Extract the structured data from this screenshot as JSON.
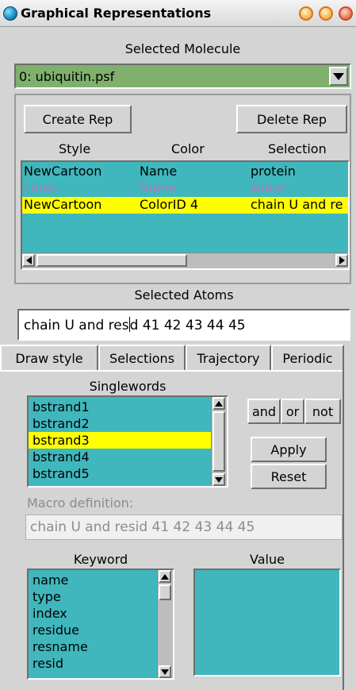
{
  "window": {
    "title": "Graphical Representations"
  },
  "molecule": {
    "label": "Selected Molecule",
    "value": "0: ubiquitin.psf"
  },
  "reps": {
    "create_label": "Create Rep",
    "delete_label": "Delete Rep",
    "columns": [
      "Style",
      "Color",
      "Selection"
    ],
    "rows": [
      {
        "style": "NewCartoon",
        "color": "Name",
        "selection": "protein"
      },
      {
        "style": "Lines",
        "color": "Name",
        "selection": "water"
      },
      {
        "style": "NewCartoon",
        "color": "ColorID 4",
        "selection": "chain U and re"
      }
    ]
  },
  "atoms": {
    "label": "Selected Atoms",
    "before_cursor": "chain U and res",
    "after_cursor": "d 41 42 43 44 45"
  },
  "tabs": [
    "Draw style",
    "Selections",
    "Trajectory",
    "Periodic"
  ],
  "singlewords": {
    "label": "Singlewords",
    "items": [
      "bstrand1",
      "bstrand2",
      "bstrand3",
      "bstrand4",
      "bstrand5"
    ]
  },
  "operators": [
    "and",
    "or",
    "not"
  ],
  "apply_label": "Apply",
  "reset_label": "Reset",
  "macro": {
    "label": "Macro definition:",
    "value": "chain U and resid 41 42 43 44 45"
  },
  "keyword": {
    "label": "Keyword",
    "items": [
      "name",
      "type",
      "index",
      "residue",
      "resname",
      "resid"
    ]
  },
  "value": {
    "label": "Value"
  },
  "colors": {
    "list_bg": "#3fb7bd",
    "highlight": "#ffff00",
    "molecule_bg": "#7fb06d",
    "disabled_text": "#b57bb5"
  }
}
